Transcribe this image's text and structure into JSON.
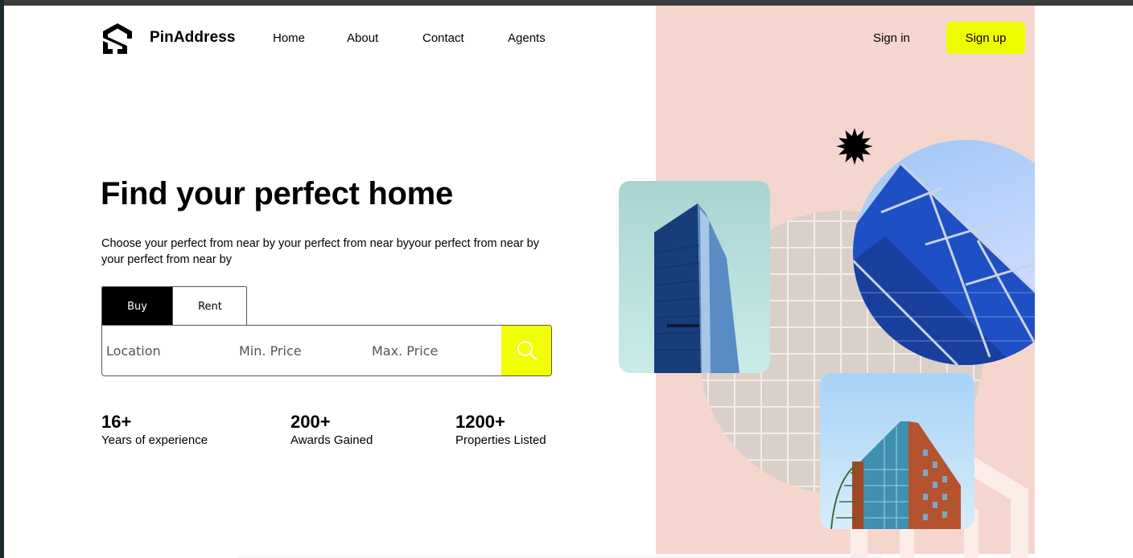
{
  "brand": {
    "name": "PinAddress",
    "logo_icon": "hexagon-s-logo-icon"
  },
  "nav": {
    "links": [
      "Home",
      "About",
      "Contact",
      "Agents"
    ]
  },
  "auth": {
    "signin_label": "Sign in",
    "signup_label": "Sign up"
  },
  "hero": {
    "title": "Find your perfect home",
    "subtitle": "Choose your perfect from near by your perfect from near byyour perfect from near by your perfect from near by"
  },
  "search": {
    "tabs": [
      "Buy",
      "Rent"
    ],
    "active_tab": "Buy",
    "location_placeholder": "Location",
    "min_price_placeholder": "Min. Price",
    "max_price_placeholder": "Max. Price",
    "button_icon": "search-icon"
  },
  "stats": [
    {
      "value": "16+",
      "label": "Years of experience"
    },
    {
      "value": "200+",
      "label": "Awards Gained"
    },
    {
      "value": "1200+",
      "label": "Properties Listed"
    }
  ],
  "colors": {
    "accent": "#eefc00",
    "panel": "#f5d6cf",
    "text": "#000000"
  }
}
